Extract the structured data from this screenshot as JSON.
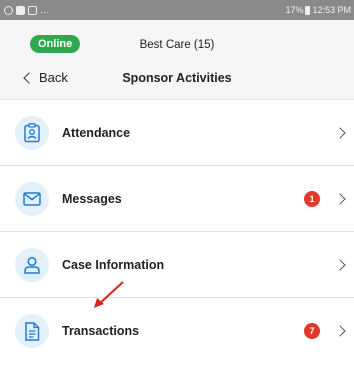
{
  "status_bar": {
    "battery": "17%",
    "time": "12:53 PM"
  },
  "header": {
    "status_label": "Online",
    "center_title": "Best Care (15)",
    "back_label": "Back",
    "page_title": "Sponsor Activities"
  },
  "menu": {
    "items": [
      {
        "label": "Attendance",
        "icon": "id-badge-icon",
        "badge": ""
      },
      {
        "label": "Messages",
        "icon": "envelope-icon",
        "badge": "1"
      },
      {
        "label": "Case Information",
        "icon": "person-icon",
        "badge": ""
      },
      {
        "label": "Transactions",
        "icon": "document-icon",
        "badge": "7"
      }
    ]
  },
  "colors": {
    "online": "#2fa84f",
    "badge": "#e2372b",
    "icon_blue": "#1e7bd6",
    "annotation_arrow": "#d22b1e"
  }
}
